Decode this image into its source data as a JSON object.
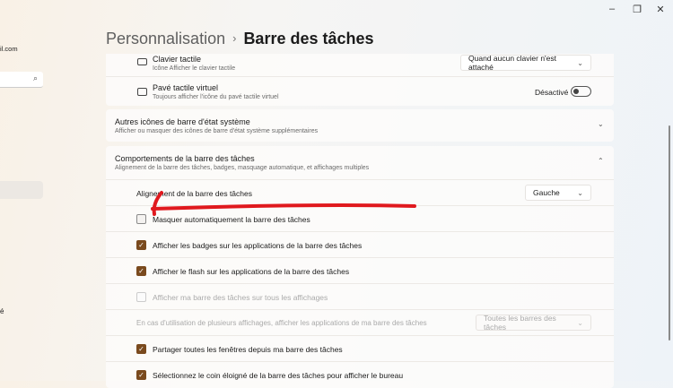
{
  "window": {
    "minimize": "–",
    "restore": "❐",
    "close": "✕"
  },
  "sidebar": {
    "email_fragment": "il.com",
    "search_icon": "search-icon",
    "footer_fragment": "é"
  },
  "breadcrumb": {
    "parent": "Personnalisation",
    "separator": "›",
    "current": "Barre des tâches"
  },
  "rows": {
    "clavier": {
      "title": "Clavier tactile",
      "subtitle": "Icône Afficher le clavier tactile",
      "value": "Quand aucun clavier n'est attaché"
    },
    "pave": {
      "title": "Pavé tactile virtuel",
      "subtitle": "Toujours afficher l'icône du pavé tactile virtuel",
      "toggle_label": "Désactivé",
      "toggle_on": false
    }
  },
  "autres": {
    "title": "Autres icônes de barre d'état système",
    "subtitle": "Afficher ou masquer des icônes de barre d'état système supplémentaires"
  },
  "comportements": {
    "title": "Comportements de la barre des tâches",
    "subtitle": "Alignement de la barre des tâches, badges, masquage automatique, et affichages multiples",
    "alignment_label": "Alignement de la barre des tâches",
    "alignment_value": "Gauche",
    "options": [
      {
        "label": "Masquer automatiquement la barre des tâches",
        "checked": false,
        "disabled": false
      },
      {
        "label": "Afficher les badges sur les applications de la barre des tâches",
        "checked": true,
        "disabled": false
      },
      {
        "label": "Afficher le flash sur les applications de la barre des tâches",
        "checked": true,
        "disabled": false
      },
      {
        "label": "Afficher ma barre des tâches sur tous les affichages",
        "checked": false,
        "disabled": true
      }
    ],
    "multi_label": "En cas d'utilisation de plusieurs affichages, afficher les applications de ma barre des tâches",
    "multi_value": "Toutes les barres des tâches",
    "options2": [
      {
        "label": "Partager toutes les fenêtres depuis ma barre des tâches",
        "checked": true
      },
      {
        "label": "Sélectionnez le coin éloigné de la barre des tâches pour afficher le bureau",
        "checked": true
      }
    ]
  },
  "colors": {
    "accent": "#7a4a1e",
    "annotation": "#e0191e"
  }
}
